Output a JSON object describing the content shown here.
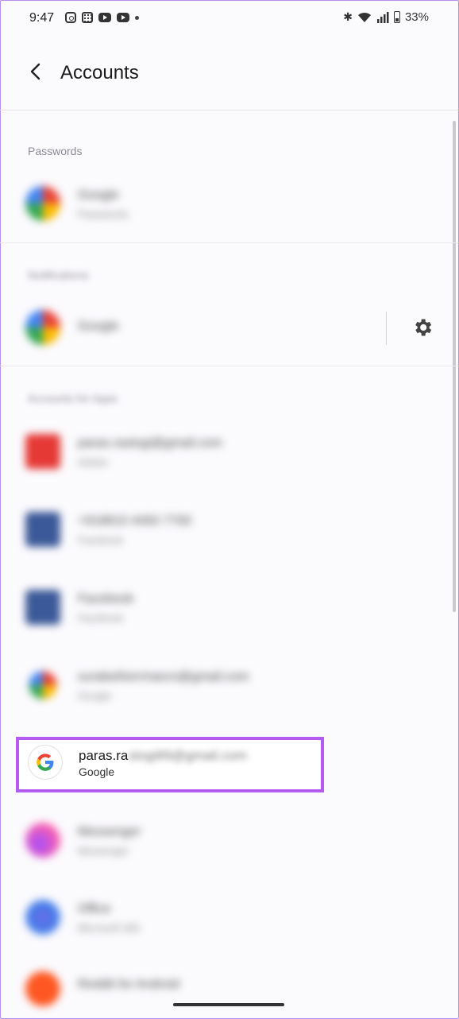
{
  "status_bar": {
    "time": "9:47",
    "battery": "33%"
  },
  "app_bar": {
    "title": "Accounts",
    "back_icon": "arrow-back-icon"
  },
  "sections": {
    "passwords": "Passwords",
    "notifications": "Notifications",
    "accounts": "Accounts for Apps"
  },
  "items": [
    {
      "title": "Google",
      "subtitle": "Passwords",
      "icon": "google-icon"
    },
    {
      "title": "Google",
      "subtitle": "",
      "icon": "google-icon"
    },
    {
      "title": "paras.rastogi@gmail.com",
      "subtitle": "Adobe",
      "icon": "adobe-icon"
    },
    {
      "title": "+918810 4450 7700",
      "subtitle": "Facebook",
      "icon": "facebook-icon"
    },
    {
      "title": "Facebook",
      "subtitle": "Facebook",
      "icon": "facebook-icon"
    },
    {
      "title": "surabetherrmacro@gmail.com",
      "subtitle": "Google",
      "icon": "google-icon"
    },
    {
      "title": "Messenger",
      "subtitle": "Messenger",
      "icon": "messenger-icon"
    },
    {
      "title": "Office",
      "subtitle": "Microsoft 365",
      "icon": "office-icon"
    },
    {
      "title": "Reddit for Android",
      "subtitle": "",
      "icon": "reddit-icon"
    }
  ],
  "highlighted": {
    "title": "paras.ra",
    "title_blurred": "stogi89@gmail.com",
    "subtitle": "Google"
  },
  "colors": {
    "highlight_border": "#b45bf2",
    "background": "#fbfafd"
  }
}
